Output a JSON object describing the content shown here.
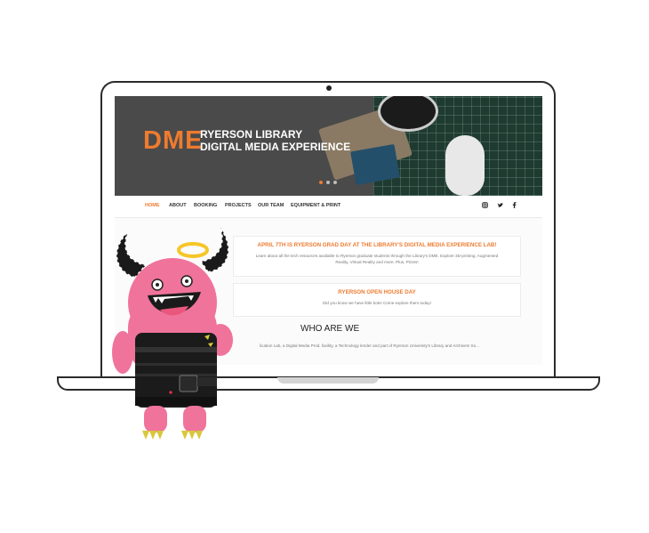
{
  "hero": {
    "logo": "DME",
    "subtitle_line1": "RYERSON LIBRARY",
    "subtitle_line2": "DIGITAL MEDIA EXPERIENCE",
    "slides": 3,
    "active_slide": 1
  },
  "nav": {
    "items": [
      "HOME",
      "ABOUT",
      "BOOKING",
      "PROJECTS",
      "OUR TEAM",
      "EQUIPMENT & PRINT"
    ],
    "active": "HOME",
    "social_icons": [
      "instagram-icon",
      "twitter-icon",
      "facebook-icon"
    ]
  },
  "cards": [
    {
      "title": "APRIL 7TH IS RYERSON GRAD DAY AT THE LIBRARY'S DIGITAL MEDIA EXPERIENCE LAB!",
      "text": "Learn about all the tech resources available to Ryerson graduate students through the Library's DME. Explore 3D-printing, Augmented Reality, Virtual Reality and more. Plus, Prizes!"
    },
    {
      "title": "RYERSON OPEN HOUSE DAY",
      "text": "Did you know we have little bots! Come explore them today!"
    }
  ],
  "who": {
    "title": "WHO ARE WE",
    "text": "lication Lab, a Digital Media Prod. facility, a Technology lender and part of Ryerson University's Library and Archives! So..."
  },
  "colors": {
    "accent": "#ee7b2f",
    "monster": "#f0739c"
  }
}
